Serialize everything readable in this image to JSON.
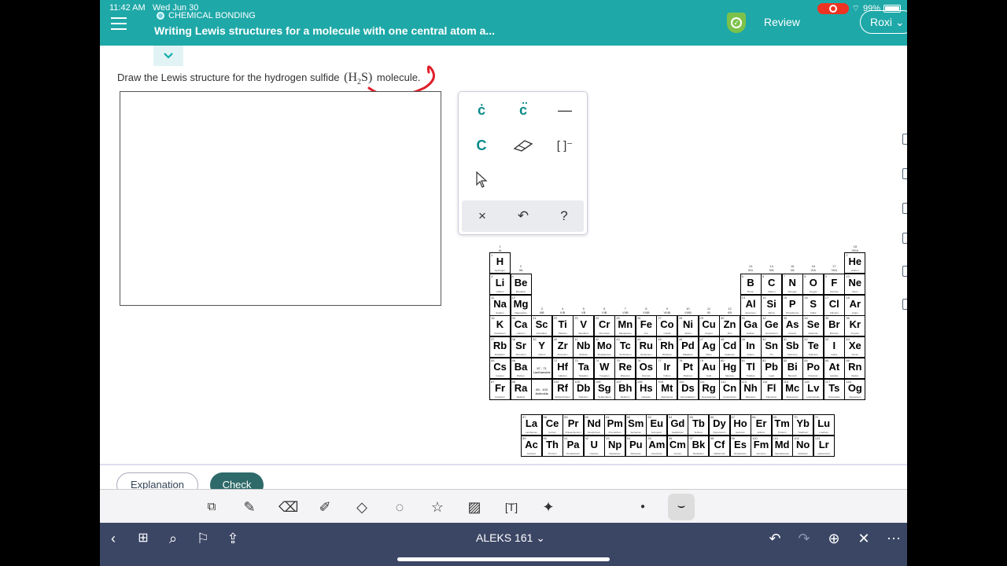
{
  "status": {
    "time": "11:42 AM",
    "date": "Wed Jun 30",
    "battery": "99%"
  },
  "header": {
    "topic": "CHEMICAL BONDING",
    "title": "Writing Lewis structures for a molecule with one central atom a...",
    "review": "Review",
    "user": "Roxi"
  },
  "question": {
    "prefix": "Draw the Lewis structure for the hydrogen sulfide",
    "formula_open": "(",
    "formula_main": "H",
    "formula_sub": "2",
    "formula_end": "S",
    "formula_close": ")",
    "suffix": "molecule."
  },
  "palette": {
    "single_dot": "ċ",
    "double_dot": "c̈",
    "bond": "—",
    "atom": "C",
    "bracket": "[ ]⁻",
    "clear": "×",
    "undo": "↶",
    "help": "?"
  },
  "buttons": {
    "explanation": "Explanation",
    "check": "Check"
  },
  "navbar": {
    "title": "ALEKS 161 ⌄"
  },
  "ptable": {
    "groups_top": [
      {
        "label": "1\nIA",
        "col": 1,
        "row": 0
      },
      {
        "label": "2\nIIA",
        "col": 2,
        "row": 1
      },
      {
        "label": "3\nIIIB",
        "col": 3,
        "row": 3
      },
      {
        "label": "4\nIVB",
        "col": 4,
        "row": 3
      },
      {
        "label": "5\nVB",
        "col": 5,
        "row": 3
      },
      {
        "label": "6\nVIB",
        "col": 6,
        "row": 3
      },
      {
        "label": "7\nVIIB",
        "col": 7,
        "row": 3
      },
      {
        "label": "8\nVIIIB",
        "col": 8,
        "row": 3
      },
      {
        "label": "9\nVIIIB",
        "col": 9,
        "row": 3
      },
      {
        "label": "10\nVIIIB",
        "col": 10,
        "row": 3
      },
      {
        "label": "11\nIB",
        "col": 11,
        "row": 3
      },
      {
        "label": "12\nIIB",
        "col": 12,
        "row": 3
      },
      {
        "label": "13\nIIIA",
        "col": 13,
        "row": 1
      },
      {
        "label": "14\nIVA",
        "col": 14,
        "row": 1
      },
      {
        "label": "15\nVA",
        "col": 15,
        "row": 1
      },
      {
        "label": "16\nVIA",
        "col": 16,
        "row": 1
      },
      {
        "label": "17\nVIIA",
        "col": 17,
        "row": 1
      },
      {
        "label": "18\nVIIIA",
        "col": 18,
        "row": 0
      }
    ],
    "elements": [
      [
        "H",
        1,
        1,
        1,
        "Hydrogen"
      ],
      [
        "He",
        2,
        18,
        1,
        "Helium"
      ],
      [
        "Li",
        3,
        1,
        2,
        "Lithium"
      ],
      [
        "Be",
        4,
        2,
        2,
        "Beryllium"
      ],
      [
        "B",
        5,
        13,
        2,
        "Boron"
      ],
      [
        "C",
        6,
        14,
        2,
        "Carbon"
      ],
      [
        "N",
        7,
        15,
        2,
        "Nitrogen"
      ],
      [
        "O",
        8,
        16,
        2,
        "Oxygen"
      ],
      [
        "F",
        9,
        17,
        2,
        "Fluorine"
      ],
      [
        "Ne",
        10,
        18,
        2,
        "Neon"
      ],
      [
        "Na",
        11,
        1,
        3,
        "Sodium"
      ],
      [
        "Mg",
        12,
        2,
        3,
        "Magnesium"
      ],
      [
        "Al",
        13,
        13,
        3,
        "Aluminum"
      ],
      [
        "Si",
        14,
        14,
        3,
        "Silicon"
      ],
      [
        "P",
        15,
        15,
        3,
        "Phosphorus"
      ],
      [
        "S",
        16,
        16,
        3,
        "Sulfur"
      ],
      [
        "Cl",
        17,
        17,
        3,
        "Chlorine"
      ],
      [
        "Ar",
        18,
        18,
        3,
        "Argon"
      ],
      [
        "K",
        19,
        1,
        4,
        "Potassium"
      ],
      [
        "Ca",
        20,
        2,
        4,
        "Calcium"
      ],
      [
        "Sc",
        21,
        3,
        4,
        "Scandium"
      ],
      [
        "Ti",
        22,
        4,
        4,
        "Titanium"
      ],
      [
        "V",
        23,
        5,
        4,
        "Vanadium"
      ],
      [
        "Cr",
        24,
        6,
        4,
        "Chromium"
      ],
      [
        "Mn",
        25,
        7,
        4,
        "Manganese"
      ],
      [
        "Fe",
        26,
        8,
        4,
        "Iron"
      ],
      [
        "Co",
        27,
        9,
        4,
        "Cobalt"
      ],
      [
        "Ni",
        28,
        10,
        4,
        "Nickel"
      ],
      [
        "Cu",
        29,
        11,
        4,
        "Copper"
      ],
      [
        "Zn",
        30,
        12,
        4,
        "Zinc"
      ],
      [
        "Ga",
        31,
        13,
        4,
        "Gallium"
      ],
      [
        "Ge",
        32,
        14,
        4,
        "Germanium"
      ],
      [
        "As",
        33,
        15,
        4,
        "Arsenic"
      ],
      [
        "Se",
        34,
        16,
        4,
        "Selenium"
      ],
      [
        "Br",
        35,
        17,
        4,
        "Bromine"
      ],
      [
        "Kr",
        36,
        18,
        4,
        "Krypton"
      ],
      [
        "Rb",
        37,
        1,
        5,
        "Rubidium"
      ],
      [
        "Sr",
        38,
        2,
        5,
        "Strontium"
      ],
      [
        "Y",
        39,
        3,
        5,
        "Yttrium"
      ],
      [
        "Zr",
        40,
        4,
        5,
        "Zirconium"
      ],
      [
        "Nb",
        41,
        5,
        5,
        "Niobium"
      ],
      [
        "Mo",
        42,
        6,
        5,
        "Molybdenum"
      ],
      [
        "Tc",
        43,
        7,
        5,
        "Technetium"
      ],
      [
        "Ru",
        44,
        8,
        5,
        "Ruthenium"
      ],
      [
        "Rh",
        45,
        9,
        5,
        "Rhodium"
      ],
      [
        "Pd",
        46,
        10,
        5,
        "Palladium"
      ],
      [
        "Ag",
        47,
        11,
        5,
        "Silver"
      ],
      [
        "Cd",
        48,
        12,
        5,
        "Cadmium"
      ],
      [
        "In",
        49,
        13,
        5,
        "Indium"
      ],
      [
        "Sn",
        50,
        14,
        5,
        "Tin"
      ],
      [
        "Sb",
        51,
        15,
        5,
        "Antimony"
      ],
      [
        "Te",
        52,
        16,
        5,
        "Tellurium"
      ],
      [
        "I",
        53,
        17,
        5,
        "Iodine"
      ],
      [
        "Xe",
        54,
        18,
        5,
        "Xenon"
      ],
      [
        "Cs",
        55,
        1,
        6,
        "Cesium"
      ],
      [
        "Ba",
        56,
        2,
        6,
        "Barium"
      ],
      [
        "Hf",
        72,
        4,
        6,
        "Hafnium"
      ],
      [
        "Ta",
        73,
        5,
        6,
        "Tantalum"
      ],
      [
        "W",
        74,
        6,
        6,
        "Tungsten"
      ],
      [
        "Re",
        75,
        7,
        6,
        "Rhenium"
      ],
      [
        "Os",
        76,
        8,
        6,
        "Osmium"
      ],
      [
        "Ir",
        77,
        9,
        6,
        "Iridium"
      ],
      [
        "Pt",
        78,
        10,
        6,
        "Platinum"
      ],
      [
        "Au",
        79,
        11,
        6,
        "Gold"
      ],
      [
        "Hg",
        80,
        12,
        6,
        "Mercury"
      ],
      [
        "Tl",
        81,
        13,
        6,
        "Thallium"
      ],
      [
        "Pb",
        82,
        14,
        6,
        "Lead"
      ],
      [
        "Bi",
        83,
        15,
        6,
        "Bismuth"
      ],
      [
        "Po",
        84,
        16,
        6,
        "Polonium"
      ],
      [
        "At",
        85,
        17,
        6,
        "Astatine"
      ],
      [
        "Rn",
        86,
        18,
        6,
        "Radon"
      ],
      [
        "Fr",
        87,
        1,
        7,
        "Francium"
      ],
      [
        "Ra",
        88,
        2,
        7,
        "Radium"
      ],
      [
        "Rf",
        104,
        4,
        7,
        "Rutherfordium"
      ],
      [
        "Db",
        105,
        5,
        7,
        "Dubnium"
      ],
      [
        "Sg",
        106,
        6,
        7,
        "Seaborgium"
      ],
      [
        "Bh",
        107,
        7,
        7,
        "Bohrium"
      ],
      [
        "Hs",
        108,
        8,
        7,
        "Hassium"
      ],
      [
        "Mt",
        109,
        9,
        7,
        "Meitnerium"
      ],
      [
        "Ds",
        110,
        10,
        7,
        "Darmstadtium"
      ],
      [
        "Rg",
        111,
        11,
        7,
        "Roentgenium"
      ],
      [
        "Cn",
        112,
        12,
        7,
        "Copernicium"
      ],
      [
        "Nh",
        113,
        13,
        7,
        "Nihonium"
      ],
      [
        "Fl",
        114,
        14,
        7,
        "Flerovium"
      ],
      [
        "Mc",
        115,
        15,
        7,
        "Moscovium"
      ],
      [
        "Lv",
        116,
        16,
        7,
        "Livermorium"
      ],
      [
        "Ts",
        117,
        17,
        7,
        "Tennessine"
      ],
      [
        "Og",
        118,
        18,
        7,
        "Oganesson"
      ]
    ],
    "lanthanide_fill": "57 - 71\nLanthanoids",
    "actinide_fill": "89 - 103\nActinoids",
    "lanthanides": [
      [
        "La",
        57,
        "Lanthanum"
      ],
      [
        "Ce",
        58,
        "Cerium"
      ],
      [
        "Pr",
        59,
        "Praseodymium"
      ],
      [
        "Nd",
        60,
        "Neodymium"
      ],
      [
        "Pm",
        61,
        "Promethium"
      ],
      [
        "Sm",
        62,
        "Samarium"
      ],
      [
        "Eu",
        63,
        "Europium"
      ],
      [
        "Gd",
        64,
        "Gadolinium"
      ],
      [
        "Tb",
        65,
        "Terbium"
      ],
      [
        "Dy",
        66,
        "Dysprosium"
      ],
      [
        "Ho",
        67,
        "Holmium"
      ],
      [
        "Er",
        68,
        "Erbium"
      ],
      [
        "Tm",
        69,
        "Thulium"
      ],
      [
        "Yb",
        70,
        "Ytterbium"
      ],
      [
        "Lu",
        71,
        "Lutetium"
      ]
    ],
    "actinides": [
      [
        "Ac",
        89,
        "Actinium"
      ],
      [
        "Th",
        90,
        "Thorium"
      ],
      [
        "Pa",
        91,
        "Protactinium"
      ],
      [
        "U",
        92,
        "Uranium"
      ],
      [
        "Np",
        93,
        "Neptunium"
      ],
      [
        "Pu",
        94,
        "Plutonium"
      ],
      [
        "Am",
        95,
        "Americium"
      ],
      [
        "Cm",
        96,
        "Curium"
      ],
      [
        "Bk",
        97,
        "Berkelium"
      ],
      [
        "Cf",
        98,
        "Californium"
      ],
      [
        "Es",
        99,
        "Einsteinium"
      ],
      [
        "Fm",
        100,
        "Fermium"
      ],
      [
        "Md",
        101,
        "Mendelevium"
      ],
      [
        "No",
        102,
        "Nobelium"
      ],
      [
        "Lr",
        103,
        "Lawrencium"
      ]
    ]
  },
  "colors": {
    "header": "#1fa8a8",
    "accent": "#0a8a8a",
    "check_button": "#2e6a6a",
    "navbar": "#3b4665",
    "annotation": "#e0202a"
  }
}
